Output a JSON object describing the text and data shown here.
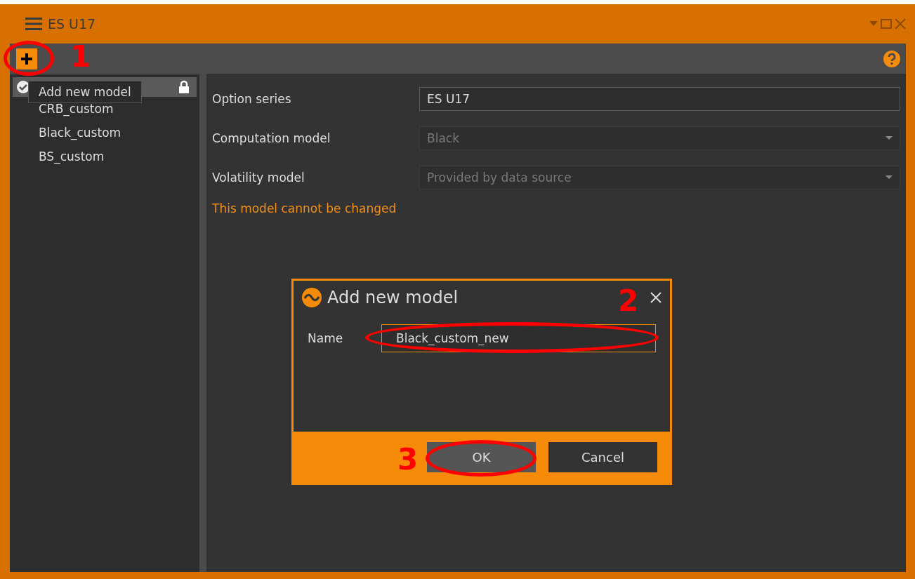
{
  "window": {
    "title": "ES U17"
  },
  "toolbar": {
    "add_tooltip": "Add new model"
  },
  "models": [
    {
      "selected": true,
      "locked": true
    },
    {
      "name": "CRB_custom",
      "selected": false,
      "locked": false
    },
    {
      "name": "Black_custom",
      "selected": false,
      "locked": false
    },
    {
      "name": "BS_custom",
      "selected": false,
      "locked": false
    }
  ],
  "form": [
    {
      "kind": "text",
      "label": "Option series",
      "value": "ES U17",
      "disabled": false
    },
    {
      "kind": "dropdown",
      "label": "Computation model",
      "value": "Black",
      "disabled": true
    },
    {
      "kind": "dropdown",
      "label": "Volatility model",
      "value": "Provided by data source",
      "disabled": true
    }
  ],
  "message": "This model cannot be changed",
  "dialog": {
    "title": "Add new model",
    "name_label": "Name",
    "name_value": "Black_custom_new",
    "buttons": [
      {
        "label": "OK",
        "highlighted": true
      },
      {
        "label": "Cancel",
        "highlighted": false
      }
    ]
  },
  "annotations": [
    {
      "label": "1"
    },
    {
      "label": "2"
    },
    {
      "label": "3"
    }
  ]
}
